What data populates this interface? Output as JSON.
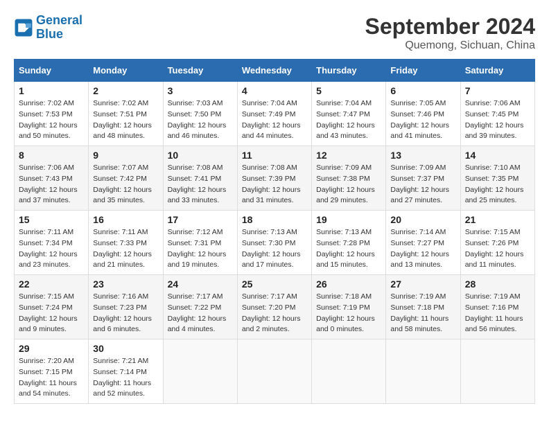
{
  "header": {
    "logo_line1": "General",
    "logo_line2": "Blue",
    "month": "September 2024",
    "location": "Quemong, Sichuan, China"
  },
  "days_of_week": [
    "Sunday",
    "Monday",
    "Tuesday",
    "Wednesday",
    "Thursday",
    "Friday",
    "Saturday"
  ],
  "weeks": [
    [
      {
        "day": 1,
        "info": "Sunrise: 7:02 AM\nSunset: 7:53 PM\nDaylight: 12 hours\nand 50 minutes."
      },
      {
        "day": 2,
        "info": "Sunrise: 7:02 AM\nSunset: 7:51 PM\nDaylight: 12 hours\nand 48 minutes."
      },
      {
        "day": 3,
        "info": "Sunrise: 7:03 AM\nSunset: 7:50 PM\nDaylight: 12 hours\nand 46 minutes."
      },
      {
        "day": 4,
        "info": "Sunrise: 7:04 AM\nSunset: 7:49 PM\nDaylight: 12 hours\nand 44 minutes."
      },
      {
        "day": 5,
        "info": "Sunrise: 7:04 AM\nSunset: 7:47 PM\nDaylight: 12 hours\nand 43 minutes."
      },
      {
        "day": 6,
        "info": "Sunrise: 7:05 AM\nSunset: 7:46 PM\nDaylight: 12 hours\nand 41 minutes."
      },
      {
        "day": 7,
        "info": "Sunrise: 7:06 AM\nSunset: 7:45 PM\nDaylight: 12 hours\nand 39 minutes."
      }
    ],
    [
      {
        "day": 8,
        "info": "Sunrise: 7:06 AM\nSunset: 7:43 PM\nDaylight: 12 hours\nand 37 minutes."
      },
      {
        "day": 9,
        "info": "Sunrise: 7:07 AM\nSunset: 7:42 PM\nDaylight: 12 hours\nand 35 minutes."
      },
      {
        "day": 10,
        "info": "Sunrise: 7:08 AM\nSunset: 7:41 PM\nDaylight: 12 hours\nand 33 minutes."
      },
      {
        "day": 11,
        "info": "Sunrise: 7:08 AM\nSunset: 7:39 PM\nDaylight: 12 hours\nand 31 minutes."
      },
      {
        "day": 12,
        "info": "Sunrise: 7:09 AM\nSunset: 7:38 PM\nDaylight: 12 hours\nand 29 minutes."
      },
      {
        "day": 13,
        "info": "Sunrise: 7:09 AM\nSunset: 7:37 PM\nDaylight: 12 hours\nand 27 minutes."
      },
      {
        "day": 14,
        "info": "Sunrise: 7:10 AM\nSunset: 7:35 PM\nDaylight: 12 hours\nand 25 minutes."
      }
    ],
    [
      {
        "day": 15,
        "info": "Sunrise: 7:11 AM\nSunset: 7:34 PM\nDaylight: 12 hours\nand 23 minutes."
      },
      {
        "day": 16,
        "info": "Sunrise: 7:11 AM\nSunset: 7:33 PM\nDaylight: 12 hours\nand 21 minutes."
      },
      {
        "day": 17,
        "info": "Sunrise: 7:12 AM\nSunset: 7:31 PM\nDaylight: 12 hours\nand 19 minutes."
      },
      {
        "day": 18,
        "info": "Sunrise: 7:13 AM\nSunset: 7:30 PM\nDaylight: 12 hours\nand 17 minutes."
      },
      {
        "day": 19,
        "info": "Sunrise: 7:13 AM\nSunset: 7:28 PM\nDaylight: 12 hours\nand 15 minutes."
      },
      {
        "day": 20,
        "info": "Sunrise: 7:14 AM\nSunset: 7:27 PM\nDaylight: 12 hours\nand 13 minutes."
      },
      {
        "day": 21,
        "info": "Sunrise: 7:15 AM\nSunset: 7:26 PM\nDaylight: 12 hours\nand 11 minutes."
      }
    ],
    [
      {
        "day": 22,
        "info": "Sunrise: 7:15 AM\nSunset: 7:24 PM\nDaylight: 12 hours\nand 9 minutes."
      },
      {
        "day": 23,
        "info": "Sunrise: 7:16 AM\nSunset: 7:23 PM\nDaylight: 12 hours\nand 6 minutes."
      },
      {
        "day": 24,
        "info": "Sunrise: 7:17 AM\nSunset: 7:22 PM\nDaylight: 12 hours\nand 4 minutes."
      },
      {
        "day": 25,
        "info": "Sunrise: 7:17 AM\nSunset: 7:20 PM\nDaylight: 12 hours\nand 2 minutes."
      },
      {
        "day": 26,
        "info": "Sunrise: 7:18 AM\nSunset: 7:19 PM\nDaylight: 12 hours\nand 0 minutes."
      },
      {
        "day": 27,
        "info": "Sunrise: 7:19 AM\nSunset: 7:18 PM\nDaylight: 11 hours\nand 58 minutes."
      },
      {
        "day": 28,
        "info": "Sunrise: 7:19 AM\nSunset: 7:16 PM\nDaylight: 11 hours\nand 56 minutes."
      }
    ],
    [
      {
        "day": 29,
        "info": "Sunrise: 7:20 AM\nSunset: 7:15 PM\nDaylight: 11 hours\nand 54 minutes."
      },
      {
        "day": 30,
        "info": "Sunrise: 7:21 AM\nSunset: 7:14 PM\nDaylight: 11 hours\nand 52 minutes."
      },
      null,
      null,
      null,
      null,
      null
    ]
  ]
}
